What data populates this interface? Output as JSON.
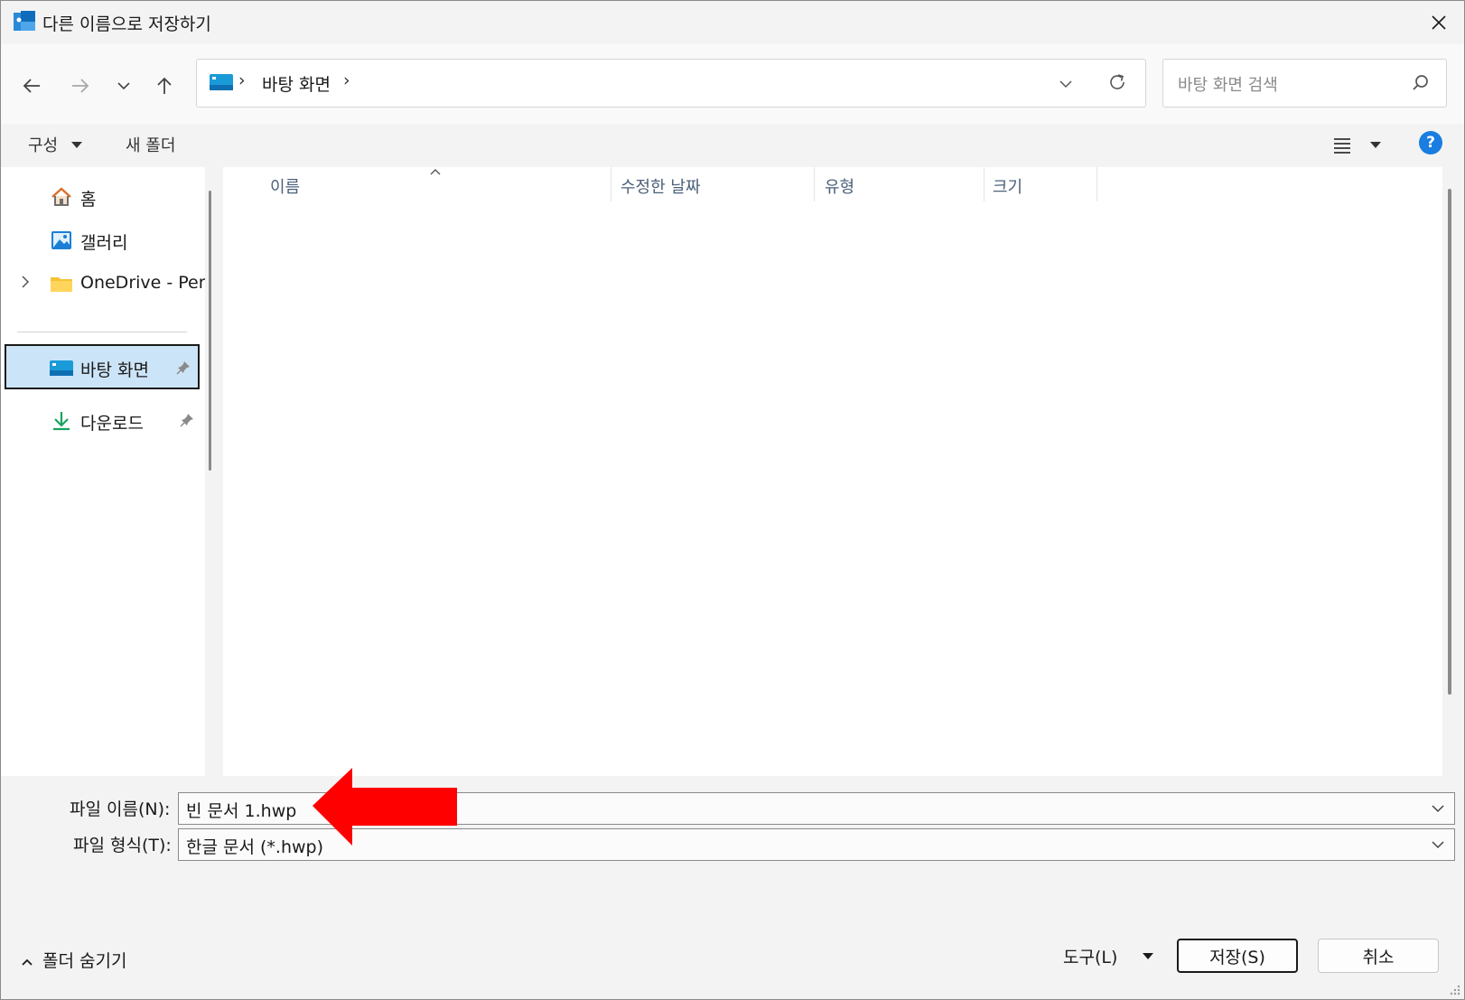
{
  "window": {
    "title": "다른 이름으로 저장하기",
    "icon": "hwp-doc-icon",
    "close_icon": "close-icon"
  },
  "nav": {
    "back_icon": "arrow-left-icon",
    "forward_icon": "arrow-right-icon",
    "recent_icon": "chevron-down-icon",
    "up_icon": "arrow-up-icon",
    "address": {
      "icon": "desktop-icon",
      "sep1": "›",
      "crumb": "바탕 화면",
      "sep2": "›"
    },
    "search_placeholder": "바탕 화면 검색"
  },
  "command_bar": {
    "organize": "구성",
    "new_folder": "새 폴더",
    "help": "?"
  },
  "nav_pane": {
    "items": [
      {
        "label": "홈",
        "icon": "home-icon"
      },
      {
        "label": "갤러리",
        "icon": "gallery-icon"
      },
      {
        "label": "OneDrive - Pers",
        "icon": "folder-icon"
      },
      {
        "label": "바탕 화면",
        "icon": "desktop-icon",
        "selected": true
      },
      {
        "label": "다운로드",
        "icon": "download-icon"
      }
    ]
  },
  "file_list": {
    "columns": [
      "이름",
      "수정한 날짜",
      "유형",
      "크기"
    ]
  },
  "fields": {
    "filename_label": "파일 이름(N):",
    "filename_value": "빈 문서 1.hwp",
    "filetype_label": "파일 형식(T):",
    "filetype_value": "한글 문서 (*.hwp)"
  },
  "bottom": {
    "hide_folders": "폴더 숨기기",
    "tools": "도구(L)",
    "save": "저장(S)",
    "cancel": "취소"
  },
  "colors": {
    "accent": "#1a7de0",
    "selected_bg": "#cce4f7",
    "arrow_overlay": "#ff0000"
  }
}
